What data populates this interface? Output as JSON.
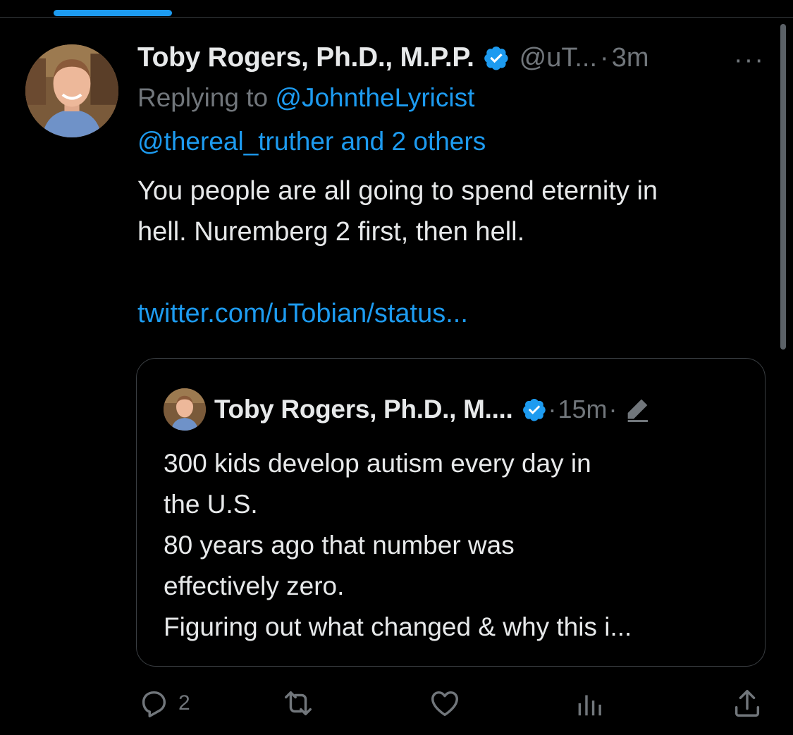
{
  "colors": {
    "background": "#000000",
    "text": "#e7e9ea",
    "secondary": "#71767b",
    "accent": "#1d9bf0"
  },
  "tweet": {
    "author_name": "Toby Rogers, Ph.D., M.P.P.",
    "handle": "@uT...",
    "separator": "·",
    "time": "3m",
    "more_label": "···",
    "replying_prefix": "Replying to ",
    "reply_mention_1": "@JohntheLyricist",
    "reply_mention_2": "@thereal_truther and 2 others",
    "body_line_1": "You people are all going to spend eternity in",
    "body_line_2": "hell. Nuremberg 2 first, then hell.",
    "link": "twitter.com/uTobian/status..."
  },
  "quoted": {
    "author_name": "Toby Rogers, Ph.D., M....",
    "separator": "·",
    "time": "15m",
    "separator_2": "·",
    "lines": [
      "300 kids develop autism every day in",
      "the U.S.",
      "80 years ago that number was",
      "effectively zero.",
      "Figuring out what changed & why this i..."
    ]
  },
  "actions": {
    "reply_count": "2",
    "icons": [
      "reply-icon",
      "retweet-icon",
      "like-icon",
      "views-icon",
      "share-icon"
    ]
  }
}
